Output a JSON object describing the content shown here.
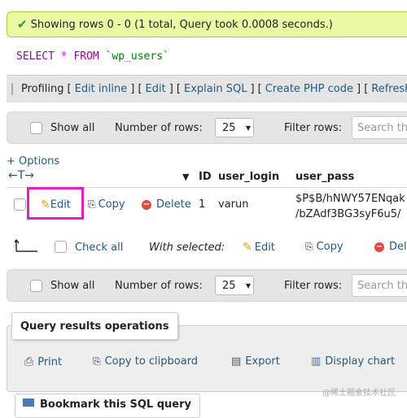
{
  "status": {
    "message": "Showing rows 0 - 0 (1 total, Query took 0.0008 seconds.)",
    "success_color": "#ebf8a4"
  },
  "sql": {
    "keyword_select": "SELECT",
    "star": "*",
    "keyword_from": "FROM",
    "table": "`wp_users`"
  },
  "query_toolbar": {
    "profiling_label": "Profiling",
    "open_bracket": "[",
    "sep": "] [",
    "links": [
      "Edit inline",
      "Edit",
      "Explain SQL",
      "Create PHP code",
      "Refresh"
    ]
  },
  "nav": {
    "show_all": "Show all",
    "number_of_rows_label": "Number of rows:",
    "rows_value": "25",
    "filter_label": "Filter rows:",
    "filter_placeholder": "Search this table"
  },
  "options_link": "+ Options",
  "table": {
    "sort_arrow_glyph": "←T→",
    "sort_triangle": "▼",
    "columns": [
      "ID",
      "user_login",
      "user_pass"
    ],
    "row": {
      "edit": "Edit",
      "copy": "Copy",
      "delete": "Delete",
      "id": "1",
      "user_login": "varun",
      "user_pass_line1": "$P$B/hNWY57ENqak",
      "user_pass_line2": "/bZAdf3BG3syF6u5/"
    }
  },
  "bulk": {
    "check_all": "Check all",
    "with_selected": "With selected:",
    "edit": "Edit",
    "copy": "Copy",
    "delete": "Delete"
  },
  "operations": {
    "legend": "Query results operations",
    "print": "Print",
    "copy_clipboard": "Copy to clipboard",
    "export": "Export",
    "display_chart": "Display chart"
  },
  "bookmark_legend": "Bookmark this SQL query",
  "watermark": "@稀土掘金技术社区"
}
